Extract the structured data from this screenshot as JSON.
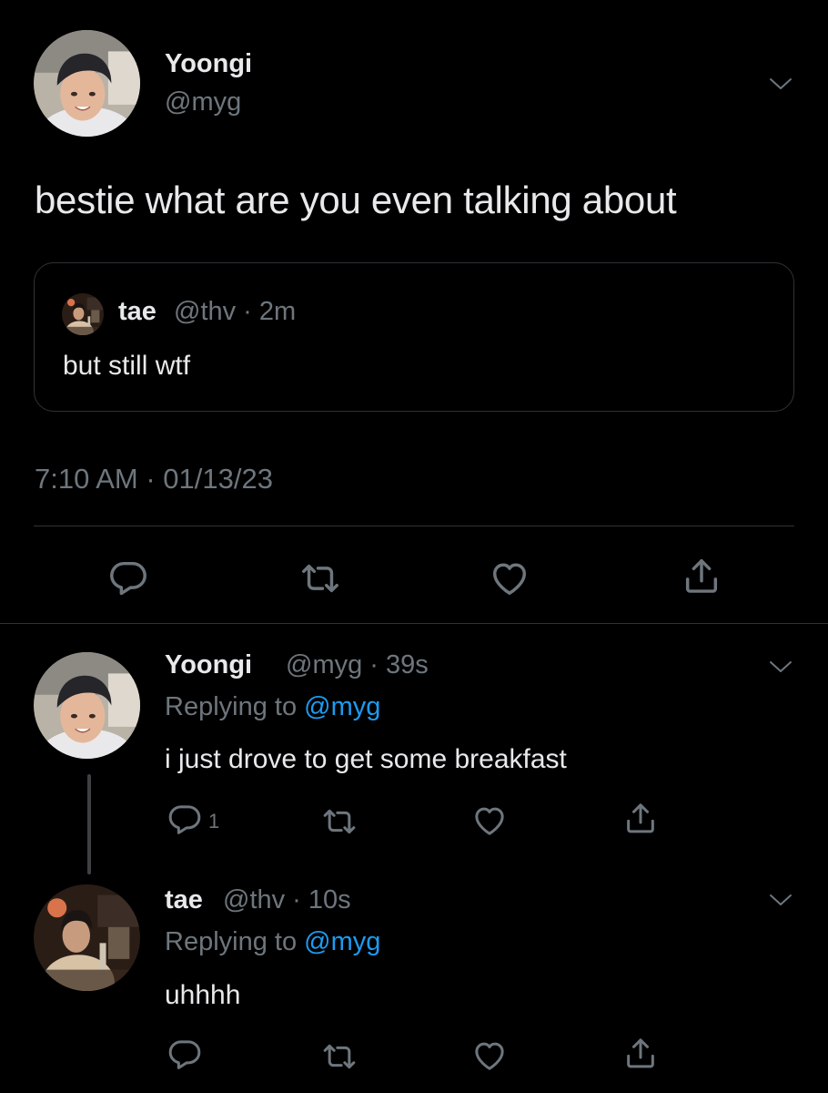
{
  "main_tweet": {
    "author_name": "Yoongi",
    "author_handle": "@myg",
    "text": "bestie what are you even talking about",
    "timestamp": "7:10 AM · 01/13/23",
    "quoted": {
      "author_name": "tae",
      "meta": "@thv · 2m",
      "text": "but still wtf"
    }
  },
  "replies": [
    {
      "author_name": "Yoongi",
      "meta": "@myg · 39s",
      "replying_prefix": "Replying to ",
      "replying_to": "@myg",
      "text": "i just drove to get some breakfast",
      "reply_count": "1"
    },
    {
      "author_name": "tae",
      "meta": "@thv · 10s",
      "replying_prefix": "Replying to ",
      "replying_to": "@myg",
      "text": "uhhhh",
      "reply_count": ""
    }
  ],
  "icons": {
    "reply": "reply-icon",
    "retweet": "retweet-icon",
    "like": "heart-icon",
    "share": "share-icon",
    "more": "chevron-down-icon"
  },
  "colors": {
    "background": "#000000",
    "text": "#e7e9ea",
    "muted": "#6e767d",
    "accent": "#1d9bf0",
    "border": "#2f3336"
  }
}
